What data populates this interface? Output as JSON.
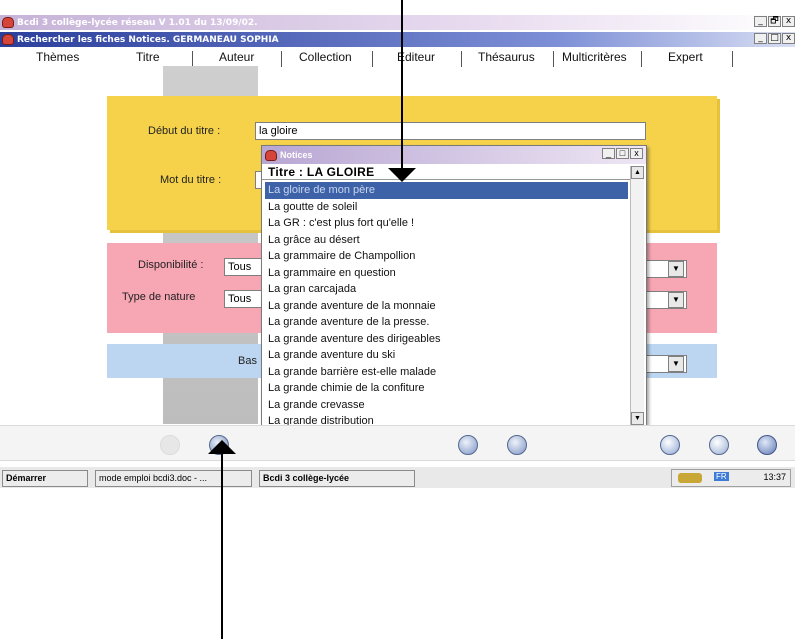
{
  "window": {
    "app_title": "Bcdi 3 collège-lycée réseau V 1.01 du 13/09/02.",
    "sub_title": "Rechercher les fiches Notices. GERMANEAU SOPHIA",
    "app_ctrls": [
      "_",
      "🗗",
      "x"
    ],
    "sub_ctrls": [
      "_",
      "□",
      "x"
    ]
  },
  "tabs": [
    "Thèmes",
    "Titre",
    "Auteur",
    "Collection",
    "Editeur",
    "Thésaurus",
    "Multicritères",
    "Expert"
  ],
  "form": {
    "debut_label": "Début du titre :",
    "debut_value": "la gloire",
    "mot_label": "Mot du titre :",
    "dispo_label": "Disponibilité :",
    "dispo_value": "Tous",
    "nature_label": "Type de nature",
    "nature_value": "Tous",
    "base_label": "Bas"
  },
  "popup": {
    "title": "Notices",
    "ctrls": [
      "_",
      "□",
      "x"
    ],
    "header": "Titre  : LA GLOIRE",
    "items": [
      "La gloire de mon père",
      "La goutte de soleil",
      "La GR : c'est plus fort qu'elle !",
      "La grâce au désert",
      "La grammaire de Champollion",
      "La grammaire en question",
      "La gran carcajada",
      "La grande aventure de la monnaie",
      "La grande aventure de la presse.",
      "La grande aventure des dirigeables",
      "La grande aventure du ski",
      "La grande barrière est-elle malade",
      "La grande chimie de la confiture",
      "La grande crevasse",
      "La grande distribution"
    ],
    "selected_index": 0
  },
  "taskbar": {
    "start": "Démarrer",
    "task1": "mode emploi bcdi3.doc - ...",
    "task2": "Bcdi 3 collège-lycée",
    "tray_lang": "FR",
    "clock": "13:37"
  },
  "colors": {
    "yellow": "#f5d24a",
    "pink": "#f7a6b4",
    "blue": "#bcd6f2",
    "selection": "#3d62a8"
  }
}
